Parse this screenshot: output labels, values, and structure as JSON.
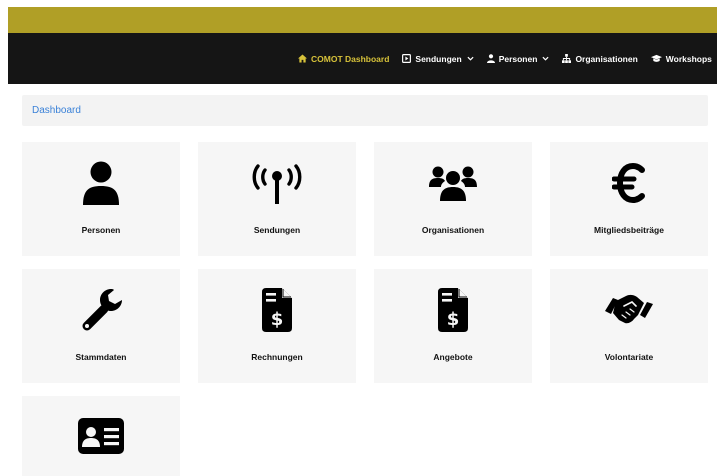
{
  "navbar": {
    "items": [
      {
        "label": "COMOT Dashboard",
        "icon": "home-icon",
        "active": true,
        "dropdown": false
      },
      {
        "label": "Sendungen",
        "icon": "play-square-icon",
        "active": false,
        "dropdown": true
      },
      {
        "label": "Personen",
        "icon": "user-icon",
        "active": false,
        "dropdown": true
      },
      {
        "label": "Organisationen",
        "icon": "sitemap-icon",
        "active": false,
        "dropdown": false
      },
      {
        "label": "Workshops",
        "icon": "graduation-cap-icon",
        "active": false,
        "dropdown": false
      }
    ]
  },
  "breadcrumb": {
    "label": "Dashboard"
  },
  "tiles": [
    {
      "label": "Personen",
      "icon": "user-icon"
    },
    {
      "label": "Sendungen",
      "icon": "broadcast-tower-icon"
    },
    {
      "label": "Organisationen",
      "icon": "users-icon"
    },
    {
      "label": "Mitgliedsbeiträge",
      "icon": "euro-icon"
    },
    {
      "label": "Stammdaten",
      "icon": "wrench-icon"
    },
    {
      "label": "Rechnungen",
      "icon": "invoice-dollar-icon"
    },
    {
      "label": "Angebote",
      "icon": "invoice-dollar-icon"
    },
    {
      "label": "Volontariate",
      "icon": "handshake-icon"
    },
    {
      "label": "",
      "icon": "id-card-icon"
    }
  ],
  "colors": {
    "gold": "#b09f26",
    "navbar": "#151515",
    "active": "#d7c23a",
    "link": "#3b82d8",
    "tile": "#f6f6f6"
  }
}
